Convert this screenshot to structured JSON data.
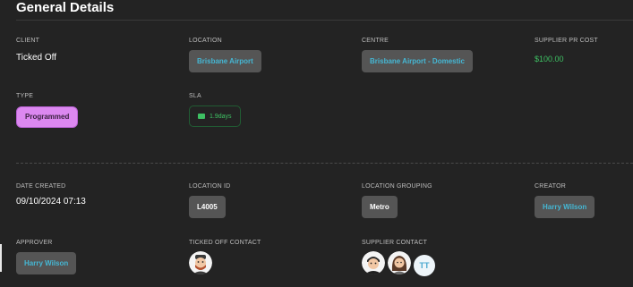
{
  "section": {
    "title": "General Details"
  },
  "fields": {
    "client": {
      "label": "CLIENT",
      "value": "Ticked Off"
    },
    "location": {
      "label": "LOCATION",
      "value": "Brisbane Airport"
    },
    "centre": {
      "label": "CENTRE",
      "value": "Brisbane Airport - Domestic"
    },
    "supplier_pr_cost": {
      "label": "SUPPLIER PR COST",
      "value": "$100.00"
    },
    "type": {
      "label": "TYPE",
      "value": "Programmed"
    },
    "sla": {
      "label": "SLA",
      "value": "1.9days",
      "icon": "flag-icon"
    },
    "date_created": {
      "label": "DATE CREATED",
      "value": "09/10/2024 07:13"
    },
    "location_id": {
      "label": "LOCATION ID",
      "value": "L4005"
    },
    "location_grouping": {
      "label": "LOCATION GROUPING",
      "value": "Metro"
    },
    "creator": {
      "label": "CREATOR",
      "value": "Harry Wilson"
    },
    "approver": {
      "label": "APPROVER",
      "value": "Harry Wilson"
    },
    "ticked_off_contact": {
      "label": "TICKED OFF CONTACT"
    },
    "supplier_contact": {
      "label": "SUPPLIER CONTACT",
      "initials": "TT"
    }
  },
  "colors": {
    "background": "#232323",
    "chip": "#555555",
    "link_blue": "#45b7d4",
    "money_green": "#3ec063",
    "programmed_purple": "#dc88f0"
  }
}
